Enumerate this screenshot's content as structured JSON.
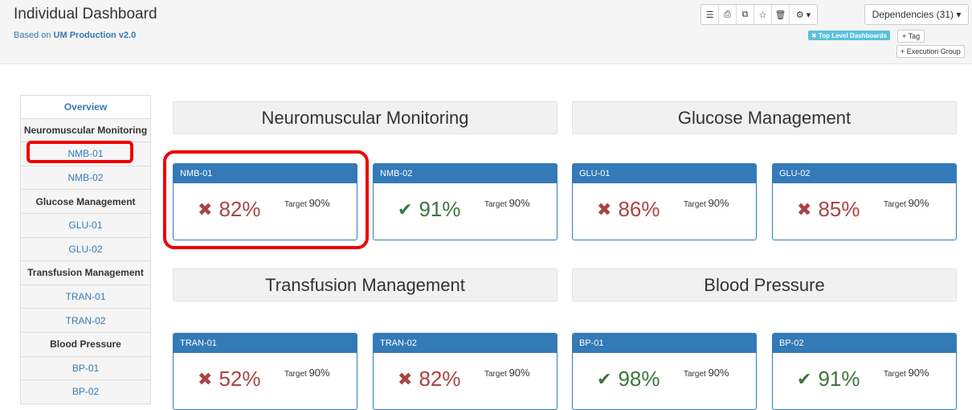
{
  "header": {
    "title": "Individual Dashboard",
    "subtitle_prefix": "Based on",
    "subtitle_link": "UM Production v2.0",
    "dependencies": "Dependencies (31) ▾",
    "tag_badge": "✖ Top Level Dashboards",
    "tag_btn": "+ Tag",
    "exec_btn": "+ Execution Group",
    "toolbar_icons": [
      "list-icon",
      "print-icon",
      "copy-icon",
      "star-icon",
      "trash-icon",
      "gear-icon"
    ]
  },
  "sidebar": {
    "items": [
      {
        "label": "Overview",
        "kind": "overview"
      },
      {
        "label": "Neuromuscular Monitoring",
        "kind": "group"
      },
      {
        "label": "NMB-01",
        "kind": "link"
      },
      {
        "label": "NMB-02",
        "kind": "link"
      },
      {
        "label": "Glucose Management",
        "kind": "group"
      },
      {
        "label": "GLU-01",
        "kind": "link"
      },
      {
        "label": "GLU-02",
        "kind": "link"
      },
      {
        "label": "Transfusion Management",
        "kind": "group"
      },
      {
        "label": "TRAN-01",
        "kind": "link"
      },
      {
        "label": "TRAN-02",
        "kind": "link"
      },
      {
        "label": "Blood Pressure",
        "kind": "group"
      },
      {
        "label": "BP-01",
        "kind": "link"
      },
      {
        "label": "BP-02",
        "kind": "link"
      }
    ]
  },
  "sections": [
    {
      "title": "Neuromuscular Monitoring"
    },
    {
      "title": "Glucose Management"
    },
    {
      "title": "Transfusion Management"
    },
    {
      "title": "Blood Pressure"
    }
  ],
  "cards": [
    {
      "id": "NMB-01",
      "value": "82%",
      "status": "bad",
      "target_label": "Target",
      "target": "90%"
    },
    {
      "id": "NMB-02",
      "value": "91%",
      "status": "good",
      "target_label": "Target",
      "target": "90%"
    },
    {
      "id": "GLU-01",
      "value": "86%",
      "status": "bad",
      "target_label": "Target",
      "target": "90%"
    },
    {
      "id": "GLU-02",
      "value": "85%",
      "status": "bad",
      "target_label": "Target",
      "target": "90%"
    },
    {
      "id": "TRAN-01",
      "value": "52%",
      "status": "bad",
      "target_label": "Target",
      "target": "90%"
    },
    {
      "id": "TRAN-02",
      "value": "82%",
      "status": "bad",
      "target_label": "Target",
      "target": "90%"
    },
    {
      "id": "BP-01",
      "value": "98%",
      "status": "good",
      "target_label": "Target",
      "target": "90%"
    },
    {
      "id": "BP-02",
      "value": "91%",
      "status": "good",
      "target_label": "Target",
      "target": "90%"
    }
  ],
  "colors": {
    "primary": "#337ab7",
    "bad": "#a94442",
    "good": "#3c763d",
    "highlight": "#ee0000"
  }
}
